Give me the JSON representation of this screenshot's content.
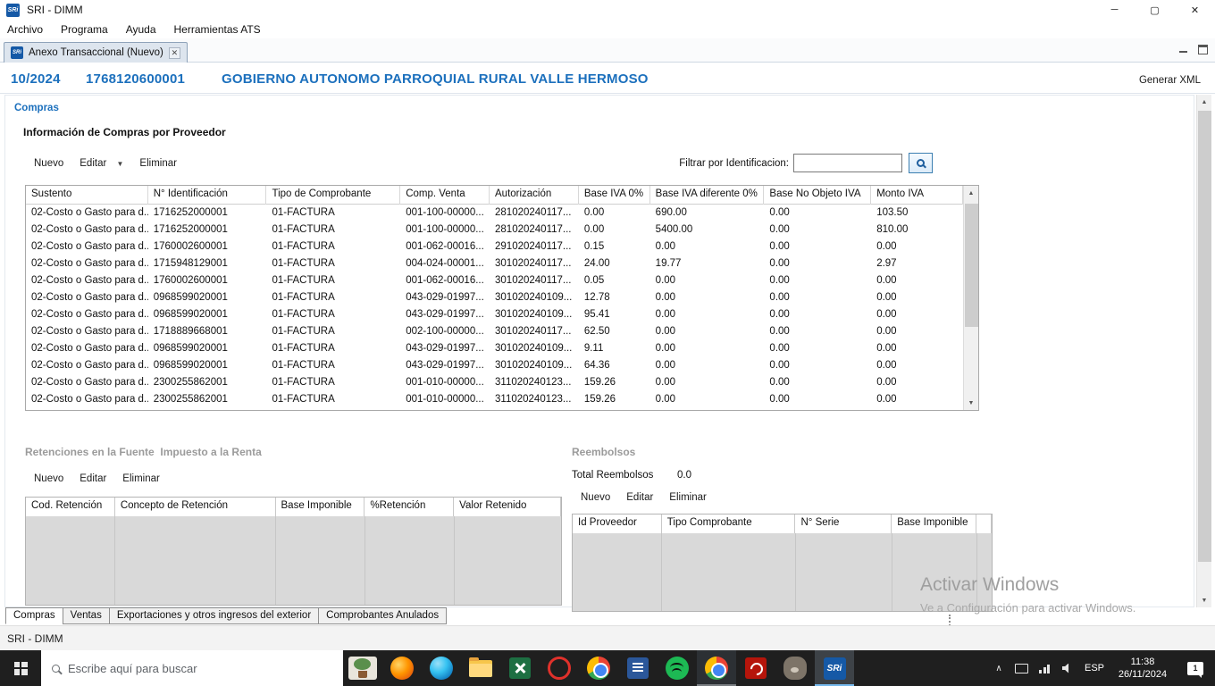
{
  "window": {
    "title": "SRI - DIMM",
    "logo_text": "SRi",
    "menu": [
      "Archivo",
      "Programa",
      "Ayuda",
      "Herramientas ATS"
    ],
    "controls": {
      "minimize": "─",
      "maximize": "▢",
      "close": "✕"
    }
  },
  "doc_tab": {
    "label": "Anexo Transaccional (Nuevo)",
    "close": "✕"
  },
  "header": {
    "period": "10/2024",
    "ruc": "1768120600001",
    "taxpayer": "GOBIERNO AUTONOMO PARROQUIAL RURAL VALLE HERMOSO",
    "generate_xml": "Generar XML"
  },
  "compras": {
    "panel_label": "Compras",
    "section_title": "Información de Compras por Proveedor",
    "toolbar": {
      "nuevo": "Nuevo",
      "editar": "Editar",
      "eliminar": "Eliminar"
    },
    "filter_label": "Filtrar por Identificacion:",
    "filter_value": "",
    "table": {
      "columns": [
        "Sustento",
        "N° Identificación",
        "Tipo de Comprobante",
        "Comp. Venta",
        "Autorización",
        "Base IVA 0%",
        "Base IVA diferente 0%",
        "Base No Objeto IVA",
        "Monto IVA"
      ],
      "rows": [
        [
          "02-Costo o Gasto para d...",
          "1716252000001",
          "01-FACTURA",
          "001-100-00000...",
          "281020240117...",
          "0.00",
          "690.00",
          "0.00",
          "103.50"
        ],
        [
          "02-Costo o Gasto para d...",
          "1716252000001",
          "01-FACTURA",
          "001-100-00000...",
          "281020240117...",
          "0.00",
          "5400.00",
          "0.00",
          "810.00"
        ],
        [
          "02-Costo o Gasto para d...",
          "1760002600001",
          "01-FACTURA",
          "001-062-00016...",
          "291020240117...",
          "0.15",
          "0.00",
          "0.00",
          "0.00"
        ],
        [
          "02-Costo o Gasto para d...",
          "1715948129001",
          "01-FACTURA",
          "004-024-00001...",
          "301020240117...",
          "24.00",
          "19.77",
          "0.00",
          "2.97"
        ],
        [
          "02-Costo o Gasto para d...",
          "1760002600001",
          "01-FACTURA",
          "001-062-00016...",
          "301020240117...",
          "0.05",
          "0.00",
          "0.00",
          "0.00"
        ],
        [
          "02-Costo o Gasto para d...",
          "0968599020001",
          "01-FACTURA",
          "043-029-01997...",
          "301020240109...",
          "12.78",
          "0.00",
          "0.00",
          "0.00"
        ],
        [
          "02-Costo o Gasto para d...",
          "0968599020001",
          "01-FACTURA",
          "043-029-01997...",
          "301020240109...",
          "95.41",
          "0.00",
          "0.00",
          "0.00"
        ],
        [
          "02-Costo o Gasto para d...",
          "1718889668001",
          "01-FACTURA",
          "002-100-00000...",
          "301020240117...",
          "62.50",
          "0.00",
          "0.00",
          "0.00"
        ],
        [
          "02-Costo o Gasto para d...",
          "0968599020001",
          "01-FACTURA",
          "043-029-01997...",
          "301020240109...",
          "9.11",
          "0.00",
          "0.00",
          "0.00"
        ],
        [
          "02-Costo o Gasto para d...",
          "0968599020001",
          "01-FACTURA",
          "043-029-01997...",
          "301020240109...",
          "64.36",
          "0.00",
          "0.00",
          "0.00"
        ],
        [
          "02-Costo o Gasto para d...",
          "2300255862001",
          "01-FACTURA",
          "001-010-00000...",
          "311020240123...",
          "159.26",
          "0.00",
          "0.00",
          "0.00"
        ],
        [
          "02-Costo o Gasto para d...",
          "2300255862001",
          "01-FACTURA",
          "001-010-00000...",
          "311020240123...",
          "159.26",
          "0.00",
          "0.00",
          "0.00"
        ]
      ]
    }
  },
  "retenciones": {
    "title_1": "Retenciones en la Fuente",
    "title_2": "Impuesto a la Renta",
    "toolbar": {
      "nuevo": "Nuevo",
      "editar": "Editar",
      "eliminar": "Eliminar"
    },
    "columns": [
      "Cod. Retención",
      "Concepto de Retención",
      "Base Imponible",
      "%Retención",
      "Valor Retenido"
    ],
    "rows": []
  },
  "reembolsos": {
    "title": "Reembolsos",
    "total_label": "Total Reembolsos",
    "total_value": "0.0",
    "toolbar": {
      "nuevo": "Nuevo",
      "editar": "Editar",
      "eliminar": "Eliminar"
    },
    "columns": [
      "Id Proveedor",
      "Tipo Comprobante",
      "N° Serie",
      "Base Imponible"
    ],
    "rows": []
  },
  "bottom_tabs": [
    "Compras",
    "Ventas",
    "Exportaciones y otros ingresos del exterior",
    "Comprobantes Anulados"
  ],
  "status_bar": "SRI - DIMM",
  "watermark": {
    "line1": "Activar Windows",
    "line2": "Ve a Configuración para activar Windows."
  },
  "taskbar": {
    "search_placeholder": "Escribe aquí para buscar",
    "language": "ESP",
    "time": "11:38",
    "date": "26/11/2024",
    "notification_count": "1"
  },
  "colors": {
    "accent_blue": "#1c70bd",
    "sri_logo_blue": "#1559a6",
    "empty_table_gray": "#d9d9d9",
    "taskbar_bg": "#1f1f1f"
  }
}
